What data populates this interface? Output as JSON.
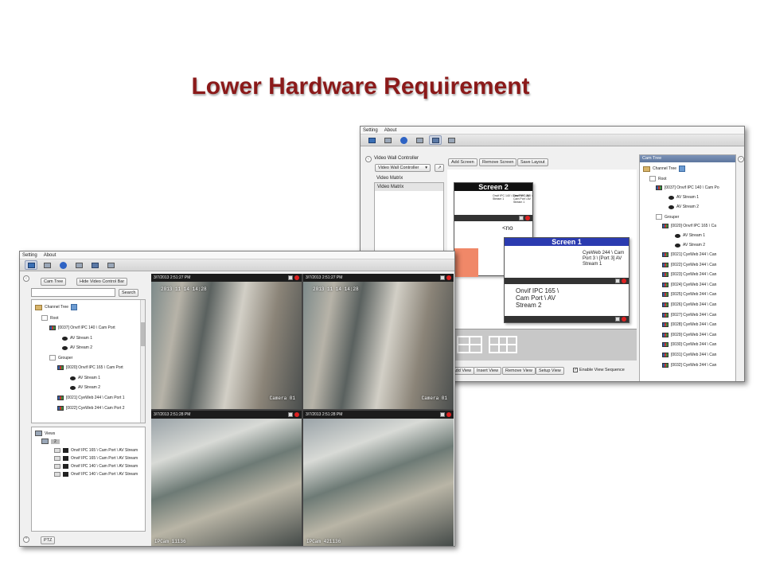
{
  "slide": {
    "title": "Lower Hardware Requirement"
  },
  "menu": {
    "setting": "Setting",
    "about": "About"
  },
  "back_window": {
    "video_wall_controller_label": "Video Wall Controller",
    "controller_select": "Video Wall Controller",
    "add_screen": "Add Screen",
    "remove_screen": "Remove Screen",
    "save_layout": "Save Layout",
    "video_matrix_label": "Video Matrix",
    "video_matrix_item": "Video Matrix",
    "screen2_title": "Screen 2",
    "screen1_title": "Screen 1",
    "screen2_cells": [
      "Onvif IPC 140 \\ Cam Port \\ AV Stream 1",
      "Onvif IPC 165 \\ Cam Port \\ AV Stream 1"
    ],
    "screen2_no": "<no",
    "screen1_cell_a": "CyeWeb 244 \\ Cam Port 3 \\ [Port 3] AV Stream 1",
    "screen1_cell_b": "Onvif IPC 165 \\ Cam Port \\ AV Stream 2",
    "add_view": "Add View",
    "insert_view": "Insert View",
    "remove_view": "Remove View",
    "setup_view": "Setup View",
    "enable_view_sequence": "Enable View Sequence",
    "cam_tree_header": "Cam Tree",
    "tree": {
      "channel_tree": "Channel Tree",
      "root": "Root",
      "cam_0037": "[0037] Onvif IPC 140 \\ Cam Po",
      "stream1": "AV Stream 1",
      "stream2": "AV Stream 2",
      "grouper": "Grouper",
      "cam_0020": "[0020] Onvif IPC 165 \\ Ca",
      "cyeweb": [
        "[0021] CyeWeb 244 \\ Can",
        "[0022] CyeWeb 244 \\ Can",
        "[0023] CyeWeb 244 \\ Can",
        "[0024] CyeWeb 244 \\ Can",
        "[0025] CyeWeb 244 \\ Can",
        "[0026] CyeWeb 244 \\ Can",
        "[0027] CyeWeb 244 \\ Can",
        "[0028] CyeWeb 244 \\ Can",
        "[0029] CyeWeb 244 \\ Can",
        "[0030] CyeWeb 244 \\ Can",
        "[0031] CyeWeb 244 \\ Can",
        "[0032] CyeWeb 244 \\ Can"
      ]
    }
  },
  "front_window": {
    "cam_tree_tab": "Cam Tree",
    "hide_video_control_bar": "Hide Video Control Bar",
    "search_button": "Search",
    "tree": {
      "channel_tree": "Channel Tree",
      "root": "Root",
      "cam_0037": "[0037] Onvif IPC 140 \\ Cam Port",
      "stream1": "AV Stream 1",
      "stream2": "AV Stream 2",
      "grouper": "Grouper",
      "cam_0020": "[0020] Onvif IPC 165 \\ Cam Port",
      "g_stream1": "AV Stream 1",
      "g_stream2": "AV Stream 2",
      "cam_0021": "[0021] CyeWeb 244 \\ Cam Port 1",
      "cam_0022": "[0022] CyeWeb 244 \\ Cam Port 2"
    },
    "views_label": "Views",
    "views_count": "2",
    "views": [
      "Onvif IPC 165 \\ Cam Port \\ AV Stream",
      "Onvif IPC 165 \\ Cam Port \\ AV Stream",
      "Onvif IPC 140 \\ Cam Port \\ AV Stream",
      "Onvif IPC 140 \\ Cam Port \\ AV Stream"
    ],
    "ptz": "PTZ",
    "tiles": [
      {
        "time": "3/7/2013 2:51:27 PM",
        "osd_top": "2013 11 14  14:28",
        "osd_bottom": "Camera 01"
      },
      {
        "time": "3/7/2013 2:51:27 PM",
        "osd_top": "2013 11 14  14:28",
        "osd_bottom": "Camera 01"
      },
      {
        "time": "3/7/2013 2:51:28 PM",
        "osd_top": "",
        "osd_bottom": "IPCam 11136"
      },
      {
        "time": "3/7/2013 2:51:28 PM",
        "osd_top": "",
        "osd_bottom": "IPCam 421136"
      }
    ]
  }
}
